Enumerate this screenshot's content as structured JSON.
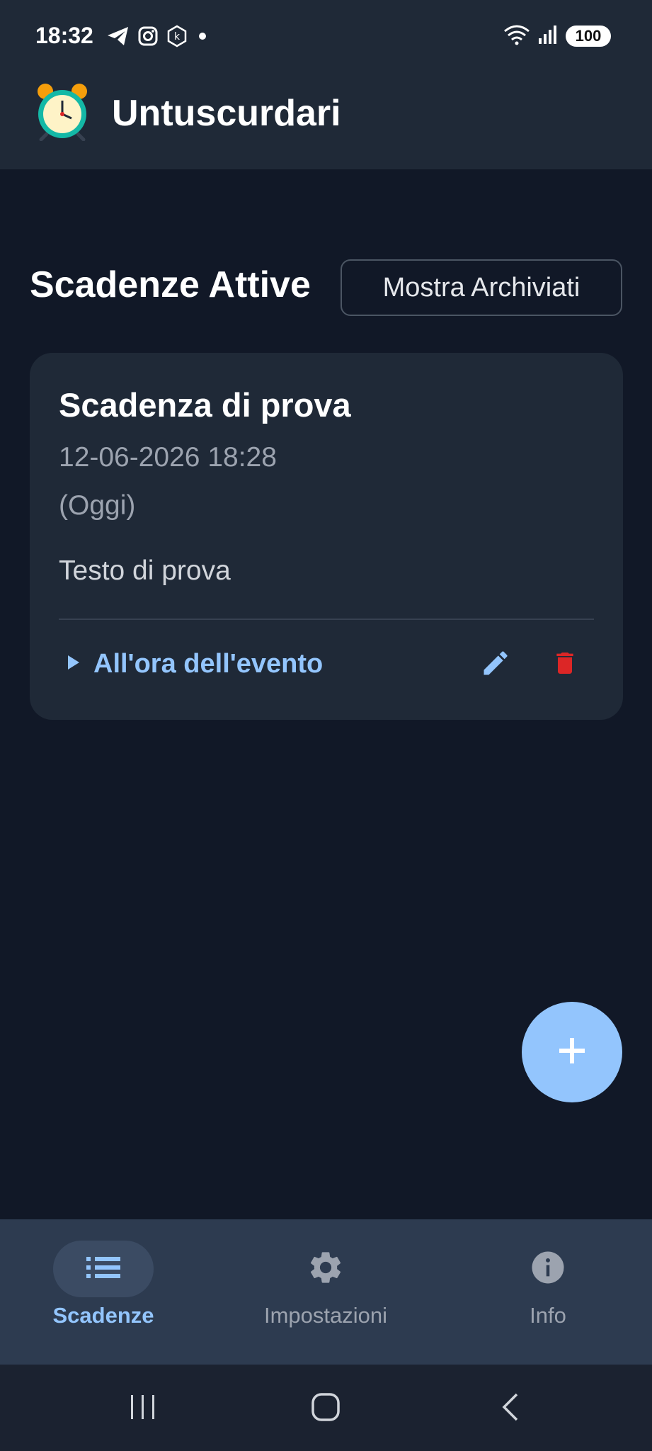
{
  "status_bar": {
    "time": "18:32",
    "left_icons": [
      "telegram-icon",
      "instagram-icon",
      "k-app-icon",
      "notification-dot-icon"
    ],
    "right_icons": [
      "wifi-icon",
      "signal-icon"
    ],
    "battery": "100"
  },
  "app_bar": {
    "title": "Untuscurdari",
    "logo_icon": "alarm-clock-icon"
  },
  "main": {
    "section_title": "Scadenze Attive",
    "archive_button": "Mostra Archiviati"
  },
  "deadline_card": {
    "title": "Scadenza di prova",
    "date": "12-06-2026 18:28",
    "relative": "(Oggi)",
    "description": "Testo di prova",
    "reminder_label": "All'ora dell'evento"
  },
  "fab_icon": "plus-icon",
  "bottom_nav": {
    "items": [
      {
        "label": "Scadenze",
        "icon": "list-icon",
        "active": true
      },
      {
        "label": "Impostazioni",
        "icon": "gear-icon",
        "active": false
      },
      {
        "label": "Info",
        "icon": "info-icon",
        "active": false
      }
    ]
  },
  "colors": {
    "background": "#111827",
    "surface": "#1f2937",
    "accent": "#93c5fd",
    "danger": "#dc2626",
    "nav_background": "#2d3b50"
  }
}
